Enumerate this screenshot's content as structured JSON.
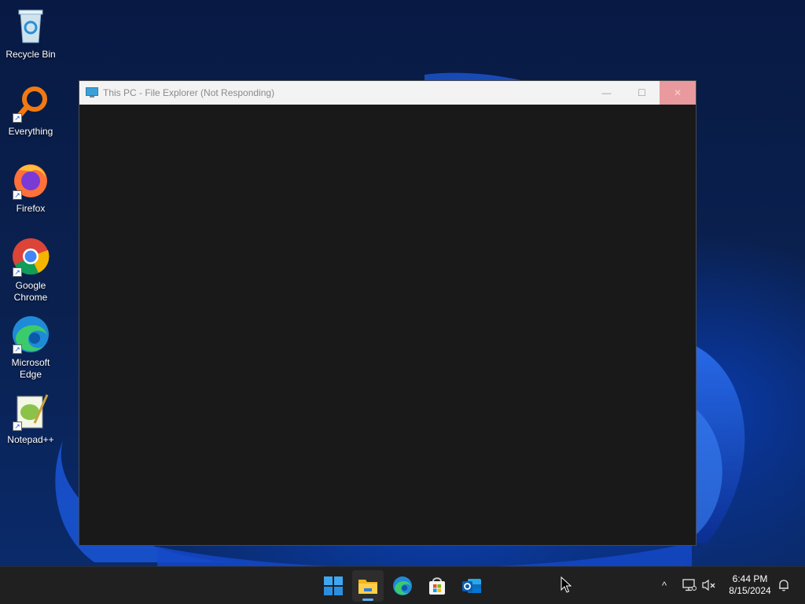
{
  "desktop": {
    "icons": [
      {
        "label": "Recycle Bin"
      },
      {
        "label": "Everything"
      },
      {
        "label": "Firefox"
      },
      {
        "label": "Google Chrome"
      },
      {
        "label": "Microsoft Edge"
      },
      {
        "label": "Notepad++"
      }
    ]
  },
  "window": {
    "title": "This PC - File Explorer (Not Responding)",
    "minimize_glyph": "—",
    "maximize_glyph": "☐",
    "close_glyph": "✕"
  },
  "taskbar": {
    "apps": [
      {
        "icon": "windows-start-icon"
      },
      {
        "icon": "file-explorer-icon",
        "active": true
      },
      {
        "icon": "edge-icon"
      },
      {
        "icon": "microsoft-store-icon"
      },
      {
        "icon": "outlook-new-icon"
      }
    ],
    "tray": {
      "chevron_glyph": "^",
      "time": "6:44 PM",
      "date": "8/15/2024"
    }
  },
  "colors": {
    "taskbar_bg": "#202020",
    "window_body": "#191919",
    "close_button": "#e89a9f",
    "accent_indicator": "#5fb2f2"
  }
}
